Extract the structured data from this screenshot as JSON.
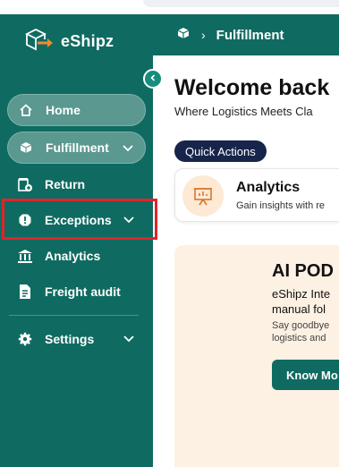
{
  "brand": {
    "name": "eShipz"
  },
  "header": {
    "breadcrumb_separator": "›",
    "title": "Fulfillment"
  },
  "sidebar": {
    "items": [
      {
        "label": "Home",
        "icon": "home-icon"
      },
      {
        "label": "Fulfillment",
        "icon": "box-icon"
      },
      {
        "label": "Return",
        "icon": "return-icon"
      },
      {
        "label": "Exceptions",
        "icon": "alert-icon"
      },
      {
        "label": "Analytics",
        "icon": "bank-icon"
      },
      {
        "label": "Freight audit",
        "icon": "document-icon"
      },
      {
        "label": "Settings",
        "icon": "gear-icon"
      }
    ]
  },
  "main": {
    "welcome": "Welcome back",
    "subtitle": "Where Logistics Meets Cla",
    "quick_actions_label": "Quick Actions",
    "card": {
      "title": "Analytics",
      "subtitle": "Gain insights with re"
    },
    "promo": {
      "title": "AI POD",
      "line1": "eShipz Inte",
      "line2": "manual fol",
      "small1": "Say goodbye",
      "small2": "logistics and",
      "button": "Know Mo"
    }
  },
  "colors": {
    "sidebar": "#0f6b61",
    "highlight": "#e0242b",
    "pill": "#5a9890",
    "promo_bg": "#fdf1e4",
    "quick_actions_bg": "#17254a"
  }
}
